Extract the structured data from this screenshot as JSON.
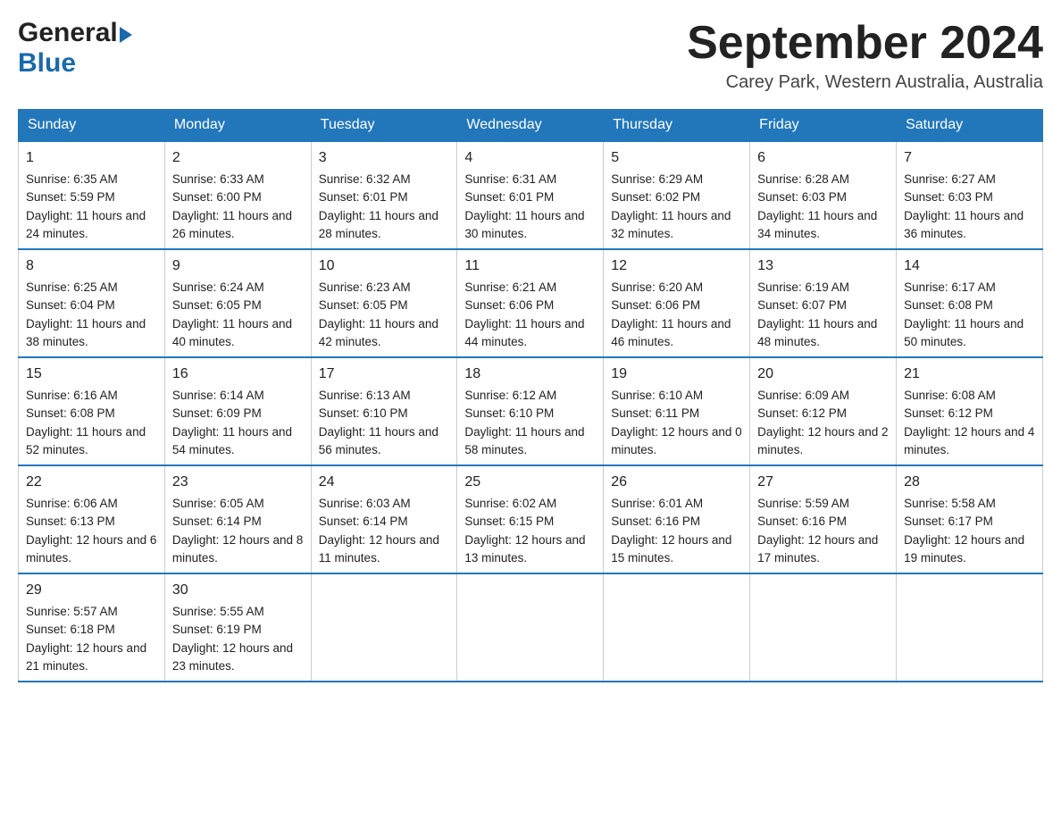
{
  "header": {
    "logo_general": "General",
    "logo_blue": "Blue",
    "calendar_title": "September 2024",
    "calendar_subtitle": "Carey Park, Western Australia, Australia"
  },
  "days": [
    "Sunday",
    "Monday",
    "Tuesday",
    "Wednesday",
    "Thursday",
    "Friday",
    "Saturday"
  ],
  "weeks": [
    {
      "days": [
        {
          "num": "1",
          "sunrise": "Sunrise: 6:35 AM",
          "sunset": "Sunset: 5:59 PM",
          "daylight": "Daylight: 11 hours and 24 minutes."
        },
        {
          "num": "2",
          "sunrise": "Sunrise: 6:33 AM",
          "sunset": "Sunset: 6:00 PM",
          "daylight": "Daylight: 11 hours and 26 minutes."
        },
        {
          "num": "3",
          "sunrise": "Sunrise: 6:32 AM",
          "sunset": "Sunset: 6:01 PM",
          "daylight": "Daylight: 11 hours and 28 minutes."
        },
        {
          "num": "4",
          "sunrise": "Sunrise: 6:31 AM",
          "sunset": "Sunset: 6:01 PM",
          "daylight": "Daylight: 11 hours and 30 minutes."
        },
        {
          "num": "5",
          "sunrise": "Sunrise: 6:29 AM",
          "sunset": "Sunset: 6:02 PM",
          "daylight": "Daylight: 11 hours and 32 minutes."
        },
        {
          "num": "6",
          "sunrise": "Sunrise: 6:28 AM",
          "sunset": "Sunset: 6:03 PM",
          "daylight": "Daylight: 11 hours and 34 minutes."
        },
        {
          "num": "7",
          "sunrise": "Sunrise: 6:27 AM",
          "sunset": "Sunset: 6:03 PM",
          "daylight": "Daylight: 11 hours and 36 minutes."
        }
      ]
    },
    {
      "days": [
        {
          "num": "8",
          "sunrise": "Sunrise: 6:25 AM",
          "sunset": "Sunset: 6:04 PM",
          "daylight": "Daylight: 11 hours and 38 minutes."
        },
        {
          "num": "9",
          "sunrise": "Sunrise: 6:24 AM",
          "sunset": "Sunset: 6:05 PM",
          "daylight": "Daylight: 11 hours and 40 minutes."
        },
        {
          "num": "10",
          "sunrise": "Sunrise: 6:23 AM",
          "sunset": "Sunset: 6:05 PM",
          "daylight": "Daylight: 11 hours and 42 minutes."
        },
        {
          "num": "11",
          "sunrise": "Sunrise: 6:21 AM",
          "sunset": "Sunset: 6:06 PM",
          "daylight": "Daylight: 11 hours and 44 minutes."
        },
        {
          "num": "12",
          "sunrise": "Sunrise: 6:20 AM",
          "sunset": "Sunset: 6:06 PM",
          "daylight": "Daylight: 11 hours and 46 minutes."
        },
        {
          "num": "13",
          "sunrise": "Sunrise: 6:19 AM",
          "sunset": "Sunset: 6:07 PM",
          "daylight": "Daylight: 11 hours and 48 minutes."
        },
        {
          "num": "14",
          "sunrise": "Sunrise: 6:17 AM",
          "sunset": "Sunset: 6:08 PM",
          "daylight": "Daylight: 11 hours and 50 minutes."
        }
      ]
    },
    {
      "days": [
        {
          "num": "15",
          "sunrise": "Sunrise: 6:16 AM",
          "sunset": "Sunset: 6:08 PM",
          "daylight": "Daylight: 11 hours and 52 minutes."
        },
        {
          "num": "16",
          "sunrise": "Sunrise: 6:14 AM",
          "sunset": "Sunset: 6:09 PM",
          "daylight": "Daylight: 11 hours and 54 minutes."
        },
        {
          "num": "17",
          "sunrise": "Sunrise: 6:13 AM",
          "sunset": "Sunset: 6:10 PM",
          "daylight": "Daylight: 11 hours and 56 minutes."
        },
        {
          "num": "18",
          "sunrise": "Sunrise: 6:12 AM",
          "sunset": "Sunset: 6:10 PM",
          "daylight": "Daylight: 11 hours and 58 minutes."
        },
        {
          "num": "19",
          "sunrise": "Sunrise: 6:10 AM",
          "sunset": "Sunset: 6:11 PM",
          "daylight": "Daylight: 12 hours and 0 minutes."
        },
        {
          "num": "20",
          "sunrise": "Sunrise: 6:09 AM",
          "sunset": "Sunset: 6:12 PM",
          "daylight": "Daylight: 12 hours and 2 minutes."
        },
        {
          "num": "21",
          "sunrise": "Sunrise: 6:08 AM",
          "sunset": "Sunset: 6:12 PM",
          "daylight": "Daylight: 12 hours and 4 minutes."
        }
      ]
    },
    {
      "days": [
        {
          "num": "22",
          "sunrise": "Sunrise: 6:06 AM",
          "sunset": "Sunset: 6:13 PM",
          "daylight": "Daylight: 12 hours and 6 minutes."
        },
        {
          "num": "23",
          "sunrise": "Sunrise: 6:05 AM",
          "sunset": "Sunset: 6:14 PM",
          "daylight": "Daylight: 12 hours and 8 minutes."
        },
        {
          "num": "24",
          "sunrise": "Sunrise: 6:03 AM",
          "sunset": "Sunset: 6:14 PM",
          "daylight": "Daylight: 12 hours and 11 minutes."
        },
        {
          "num": "25",
          "sunrise": "Sunrise: 6:02 AM",
          "sunset": "Sunset: 6:15 PM",
          "daylight": "Daylight: 12 hours and 13 minutes."
        },
        {
          "num": "26",
          "sunrise": "Sunrise: 6:01 AM",
          "sunset": "Sunset: 6:16 PM",
          "daylight": "Daylight: 12 hours and 15 minutes."
        },
        {
          "num": "27",
          "sunrise": "Sunrise: 5:59 AM",
          "sunset": "Sunset: 6:16 PM",
          "daylight": "Daylight: 12 hours and 17 minutes."
        },
        {
          "num": "28",
          "sunrise": "Sunrise: 5:58 AM",
          "sunset": "Sunset: 6:17 PM",
          "daylight": "Daylight: 12 hours and 19 minutes."
        }
      ]
    },
    {
      "days": [
        {
          "num": "29",
          "sunrise": "Sunrise: 5:57 AM",
          "sunset": "Sunset: 6:18 PM",
          "daylight": "Daylight: 12 hours and 21 minutes."
        },
        {
          "num": "30",
          "sunrise": "Sunrise: 5:55 AM",
          "sunset": "Sunset: 6:19 PM",
          "daylight": "Daylight: 12 hours and 23 minutes."
        },
        null,
        null,
        null,
        null,
        null
      ]
    }
  ]
}
